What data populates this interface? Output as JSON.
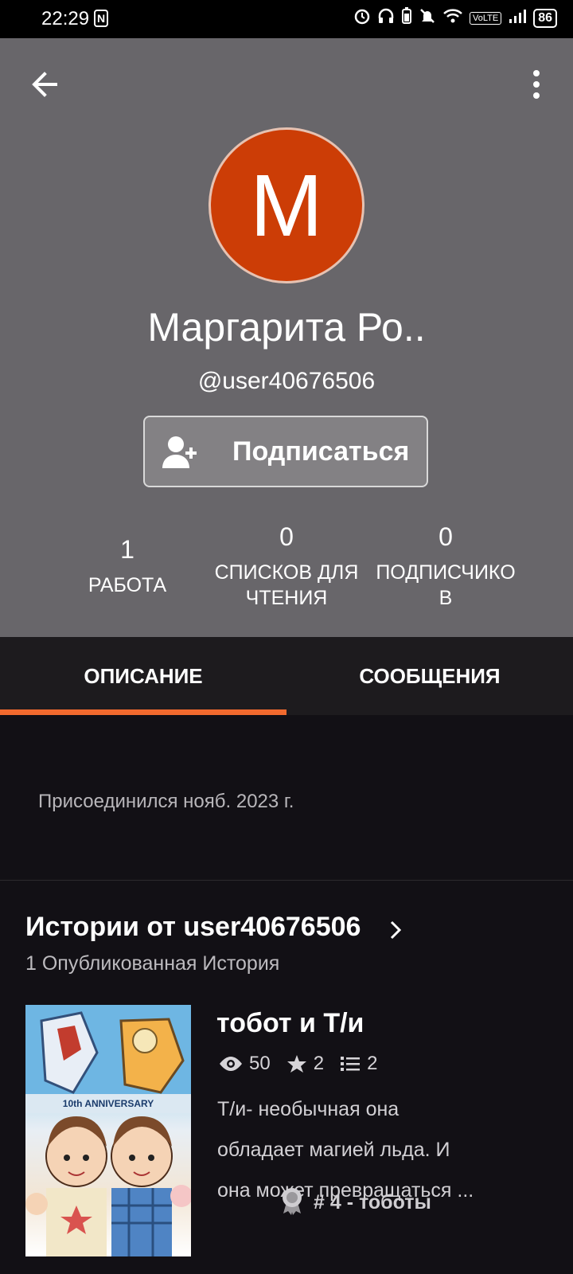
{
  "status_bar": {
    "time": "22:29",
    "nfc": "N",
    "volte": "VoLTE",
    "battery": "86",
    "icons": [
      "alarm-icon",
      "headphones-icon",
      "battery-saver-icon",
      "mute-icon",
      "wifi-icon",
      "signal-icon"
    ]
  },
  "profile": {
    "avatar_letter": "M",
    "avatar_color": "#cc3d06",
    "display_name": "Маргарита Ро..",
    "username": "@user40676506",
    "follow_label": "Подписаться",
    "header_color": "#68666a"
  },
  "stats": {
    "works": {
      "value": "1",
      "label": "РАБОТА"
    },
    "reading_lists": {
      "value": "0",
      "label_line1": "СПИСКОВ ДЛЯ",
      "label_line2": "ЧТЕНИЯ"
    },
    "followers": {
      "value": "0",
      "label_line1": "ПОДПИСЧИКО",
      "label_line2": "В"
    }
  },
  "tabs": [
    {
      "label": "ОПИСАНИЕ",
      "active": true
    },
    {
      "label": "СООБЩЕНИЯ",
      "active": false
    }
  ],
  "accent_color": "#f26a2e",
  "about": {
    "joined": "Присоединился нояб. 2023 г."
  },
  "stories": {
    "title": "Истории от user40676506",
    "count_text": "1 Опубликованная История",
    "items": [
      {
        "title": "тобот и Т/и",
        "views": "50",
        "votes": "2",
        "parts": "2",
        "desc_line1": "Т/и- необычная она",
        "desc_line2": "обладает магией льда. И",
        "desc_line3": "она может превращаться ...",
        "rank": "# 4 - тоботы",
        "cover_text": "10th ANNIVERSARY"
      }
    ]
  }
}
